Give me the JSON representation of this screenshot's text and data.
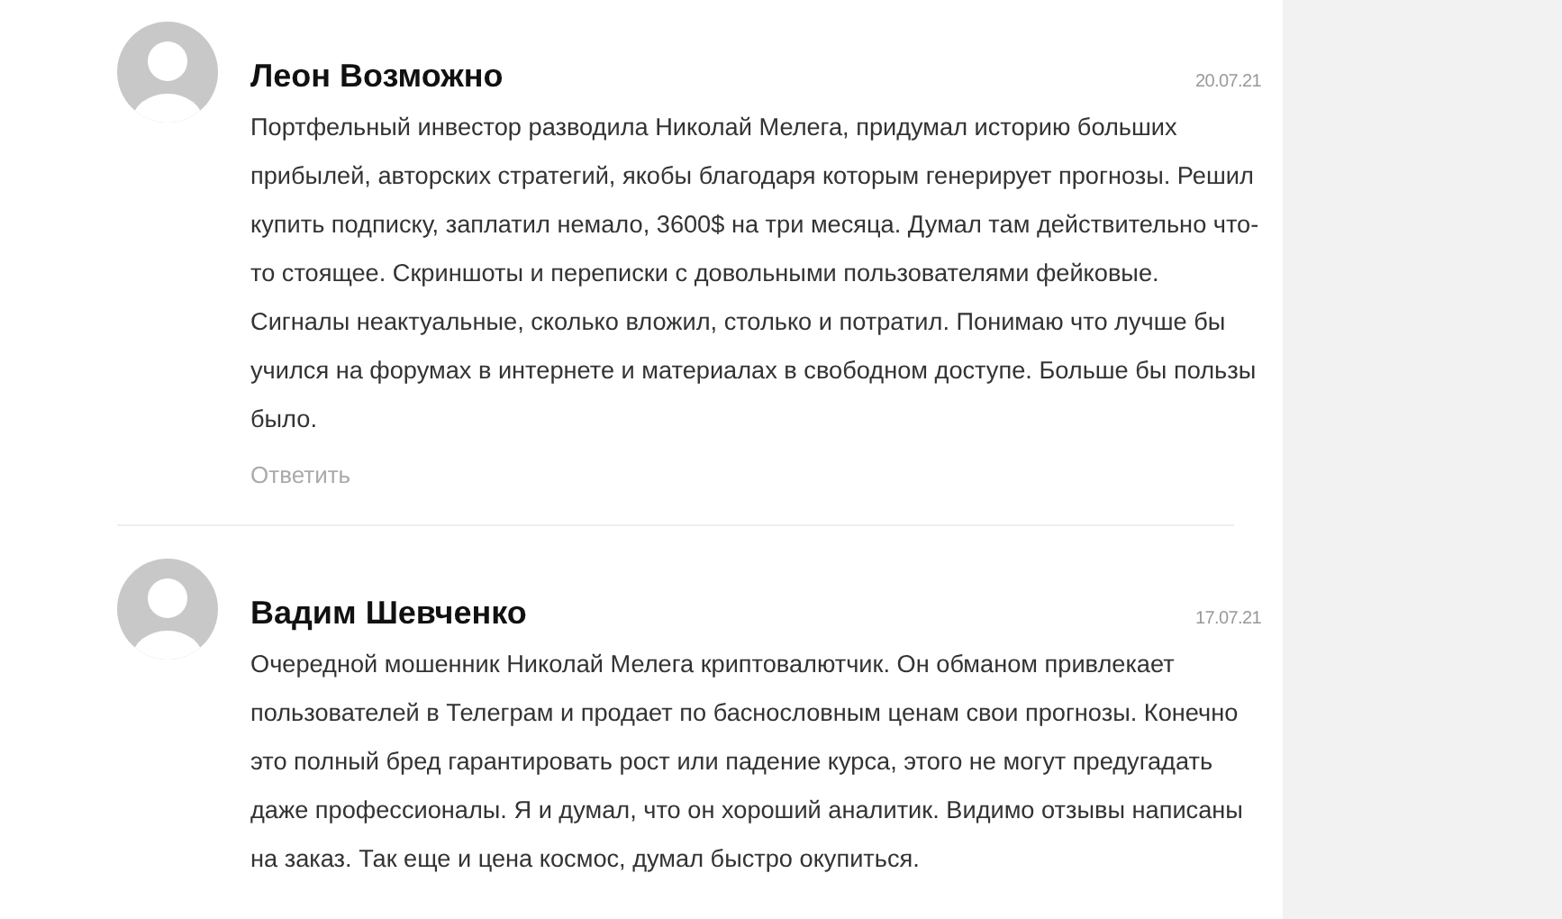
{
  "comments": [
    {
      "author": "Леон Возможно",
      "date": "20.07.21",
      "text": "Портфельный инвестор разводила Николай Мелега, придумал историю больших прибылей, авторских стратегий, якобы благодаря которым генерирует прогнозы. Решил купить подписку, заплатил немало, 3600$ на три месяца. Думал там действительно что-то стоящее. Скриншоты и переписки с довольными пользователями фейковые. Сигналы неактуальные, сколько вложил, столько и потратил. Понимаю что лучше бы учился на форумах в интернете и материалах в свободном доступе. Больше бы пользы было.",
      "reply": "Ответить"
    },
    {
      "author": "Вадим Шевченко",
      "date": "17.07.21",
      "text": "Очередной мошенник Николай Мелега криптовалютчик. Он обманом привлекает пользователей в Телеграм и продает по баснословным ценам свои прогнозы. Конечно это полный бред гарантировать рост или падение курса, этого не могут предугадать даже профессионалы. Я и думал, что он хороший аналитик. Видимо отзывы написаны на заказ. Так еще и цена космос, думал быстро окупиться."
    }
  ]
}
